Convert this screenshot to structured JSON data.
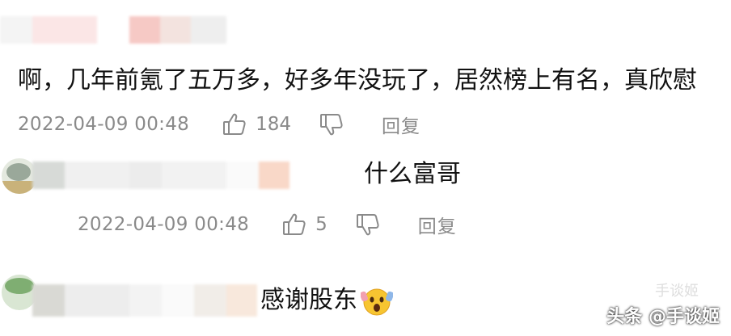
{
  "comments": [
    {
      "text": "啊，几年前氪了五万多，好多年没玩了，居然榜上有名，真欣慰",
      "time": "2022-04-09 00:48",
      "likes": "184",
      "reply_label": "回复"
    }
  ],
  "replies": [
    {
      "text": "什么富哥",
      "time": "2022-04-09 00:48",
      "likes": "5",
      "reply_label": "回复"
    },
    {
      "text": "感谢股东"
    }
  ],
  "watermark": {
    "platform": "头条",
    "account": "@手谈姬",
    "ghost": "手谈姬"
  },
  "colors": {
    "text": "#111111",
    "meta": "#8a8a8a",
    "icon": "#8a8a8a"
  }
}
